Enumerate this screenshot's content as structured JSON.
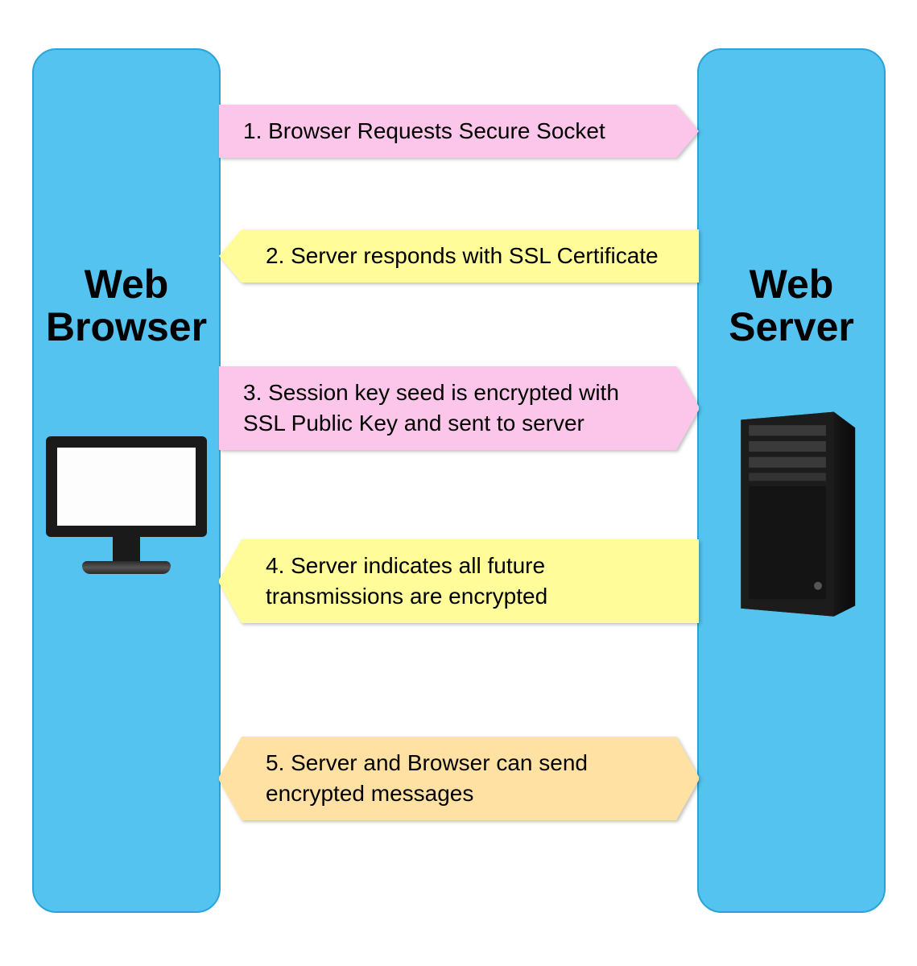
{
  "browser_label_line1": "Web",
  "browser_label_line2": "Browser",
  "server_label_line1": "Web",
  "server_label_line2": "Server",
  "steps": {
    "s1": "1. Browser Requests Secure Socket",
    "s2": "2. Server responds with SSL Certificate",
    "s3": "3. Session key seed is encrypted with SSL Public Key and sent to server",
    "s4": "4. Server indicates all future transmissions are encrypted",
    "s5": "5. Server and Browser can send encrypted messages"
  },
  "directions": {
    "s1": "right",
    "s2": "left",
    "s3": "right",
    "s4": "left",
    "s5": "both"
  },
  "colors": {
    "pillar": "#55c3ef",
    "pink": "#fcc6ea",
    "yellow": "#fffc99",
    "orange": "#ffe1a3"
  }
}
